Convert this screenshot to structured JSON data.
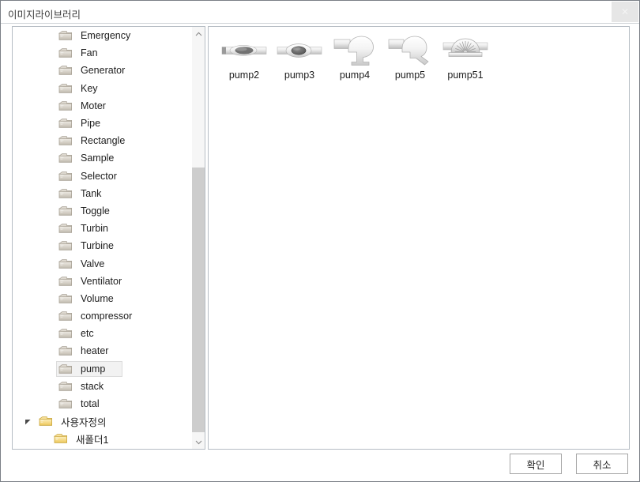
{
  "window": {
    "title": "이미지라이브러리",
    "close_label": "✕"
  },
  "tree": {
    "items": [
      {
        "label": "Emergency",
        "depth": 2,
        "icon": "folder-gray-icon",
        "selected": false,
        "twisty": ""
      },
      {
        "label": "Fan",
        "depth": 2,
        "icon": "folder-gray-icon",
        "selected": false,
        "twisty": ""
      },
      {
        "label": "Generator",
        "depth": 2,
        "icon": "folder-gray-icon",
        "selected": false,
        "twisty": ""
      },
      {
        "label": "Key",
        "depth": 2,
        "icon": "folder-gray-icon",
        "selected": false,
        "twisty": ""
      },
      {
        "label": "Moter",
        "depth": 2,
        "icon": "folder-gray-icon",
        "selected": false,
        "twisty": ""
      },
      {
        "label": "Pipe",
        "depth": 2,
        "icon": "folder-gray-icon",
        "selected": false,
        "twisty": ""
      },
      {
        "label": "Rectangle",
        "depth": 2,
        "icon": "folder-gray-icon",
        "selected": false,
        "twisty": ""
      },
      {
        "label": "Sample",
        "depth": 2,
        "icon": "folder-gray-icon",
        "selected": false,
        "twisty": ""
      },
      {
        "label": "Selector",
        "depth": 2,
        "icon": "folder-gray-icon",
        "selected": false,
        "twisty": ""
      },
      {
        "label": "Tank",
        "depth": 2,
        "icon": "folder-gray-icon",
        "selected": false,
        "twisty": ""
      },
      {
        "label": "Toggle",
        "depth": 2,
        "icon": "folder-gray-icon",
        "selected": false,
        "twisty": ""
      },
      {
        "label": "Turbin",
        "depth": 2,
        "icon": "folder-gray-icon",
        "selected": false,
        "twisty": ""
      },
      {
        "label": "Turbine",
        "depth": 2,
        "icon": "folder-gray-icon",
        "selected": false,
        "twisty": ""
      },
      {
        "label": "Valve",
        "depth": 2,
        "icon": "folder-gray-icon",
        "selected": false,
        "twisty": ""
      },
      {
        "label": "Ventilator",
        "depth": 2,
        "icon": "folder-gray-icon",
        "selected": false,
        "twisty": ""
      },
      {
        "label": "Volume",
        "depth": 2,
        "icon": "folder-gray-icon",
        "selected": false,
        "twisty": ""
      },
      {
        "label": "compressor",
        "depth": 2,
        "icon": "folder-gray-icon",
        "selected": false,
        "twisty": ""
      },
      {
        "label": "etc",
        "depth": 2,
        "icon": "folder-gray-icon",
        "selected": false,
        "twisty": ""
      },
      {
        "label": "heater",
        "depth": 2,
        "icon": "folder-gray-icon",
        "selected": false,
        "twisty": ""
      },
      {
        "label": "pump",
        "depth": 2,
        "icon": "folder-gray-icon",
        "selected": true,
        "twisty": ""
      },
      {
        "label": "stack",
        "depth": 2,
        "icon": "folder-gray-icon",
        "selected": false,
        "twisty": ""
      },
      {
        "label": "total",
        "depth": 2,
        "icon": "folder-gray-icon",
        "selected": false,
        "twisty": ""
      },
      {
        "label": "사용자정의",
        "depth": 1,
        "icon": "folder-yellow-icon",
        "selected": false,
        "twisty": "expanded-triangle-icon"
      },
      {
        "label": "새폴더1",
        "depth": 3,
        "icon": "folder-yellow-icon",
        "selected": false,
        "twisty": ""
      }
    ],
    "scrollbar": {
      "up_arrow": "chevron-up-icon",
      "down_arrow": "chevron-down-icon"
    }
  },
  "content": {
    "thumbnails": [
      {
        "label": "pump2",
        "icon": "pump2-icon"
      },
      {
        "label": "pump3",
        "icon": "pump3-icon"
      },
      {
        "label": "pump4",
        "icon": "pump4-icon"
      },
      {
        "label": "pump5",
        "icon": "pump5-icon"
      },
      {
        "label": "pump51",
        "icon": "pump51-icon"
      }
    ]
  },
  "footer": {
    "ok_label": "확인",
    "cancel_label": "취소"
  },
  "colors": {
    "window_border": "#7a7f86",
    "panel_border": "#b6bdc4",
    "selection_fill": "#f2f2f2",
    "selection_border": "#dcdcdc",
    "scroll_thumb": "#cdcdcd",
    "scroll_track": "#f6f6f6",
    "folder_gray": "#cfc9bd",
    "folder_yellow": "#f2d16b",
    "text": "#1d1d1d",
    "title_text": "#3a3a3a"
  }
}
